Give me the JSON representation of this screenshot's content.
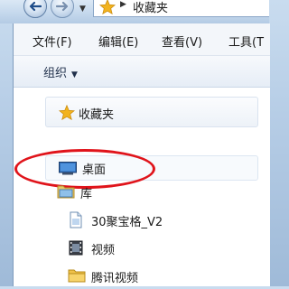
{
  "address": {
    "back_icon": "back-arrow-icon",
    "forward_icon": "forward-arrow-icon",
    "location_icon": "star-icon",
    "path": "收藏夹"
  },
  "menubar": {
    "items": [
      "文件(F)",
      "编辑(E)",
      "查看(V)",
      "工具(T"
    ]
  },
  "toolbar": {
    "organize_label": "组织",
    "dropdown_icon": "chevron-down-icon"
  },
  "nav_pane": {
    "favorites": {
      "label": "收藏夹",
      "icon": "star-icon"
    },
    "desktop": {
      "label": "桌面",
      "icon": "desktop-icon",
      "highlighted": true
    },
    "library": {
      "label": "库",
      "icon": "library-folder-icon"
    },
    "library_items": [
      {
        "label": "30聚宝格_V2",
        "icon": "document-icon"
      },
      {
        "label": "视频",
        "icon": "video-icon"
      },
      {
        "label": "腾讯视频",
        "icon": "folder-icon"
      }
    ]
  },
  "colors": {
    "highlight": "#e0141b",
    "star": "#f2b31e",
    "window_frame": "#b6cde6"
  }
}
